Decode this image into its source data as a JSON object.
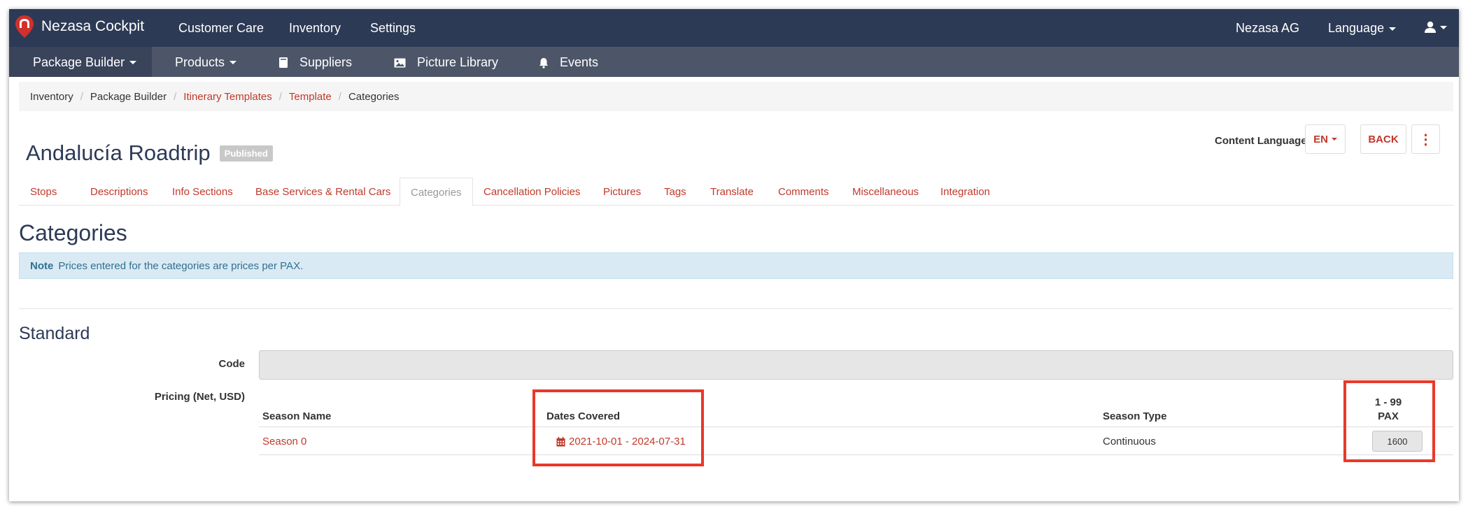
{
  "topnav": {
    "brand": "Nezasa Cockpit",
    "items": [
      "Customer Care",
      "Inventory",
      "Settings"
    ],
    "company": "Nezasa AG",
    "language": "Language"
  },
  "subnav": {
    "items": [
      "Package Builder",
      "Products",
      "Suppliers",
      "Picture Library",
      "Events"
    ]
  },
  "breadcrumb": [
    "Inventory",
    "Package Builder",
    "Itinerary Templates",
    "Template",
    "Categories"
  ],
  "page": {
    "title": "Andalucía Roadtrip",
    "status_badge": "Published",
    "content_language_label": "Content Language",
    "content_language_value": "EN",
    "back_label": "BACK",
    "more_glyph": "⋮"
  },
  "tabs": [
    "Stops",
    "Descriptions",
    "Info Sections",
    "Base Services & Rental Cars",
    "Categories",
    "Cancellation Policies",
    "Pictures",
    "Tags",
    "Translate",
    "Comments",
    "Miscellaneous",
    "Integration"
  ],
  "section": {
    "title": "Categories",
    "note_label": "Note",
    "note_text": "Prices entered for the categories are prices per PAX."
  },
  "category": {
    "name": "Standard",
    "code_label": "Code",
    "code_value": "",
    "pricing_label": "Pricing (Net, USD)",
    "columns": {
      "season_name": "Season Name",
      "dates_covered": "Dates Covered",
      "season_type": "Season Type",
      "pax_range": "1 - 99",
      "pax_label": "PAX"
    },
    "rows": [
      {
        "season_name": "Season 0",
        "dates_covered": "2021-10-01 - 2024-07-31",
        "season_type": "Continuous",
        "price": "1600"
      }
    ]
  },
  "colors": {
    "navbar": "#2d3a55",
    "subnav": "#4d5668",
    "accent": "#c0392b",
    "highlight": "#e8392a"
  }
}
